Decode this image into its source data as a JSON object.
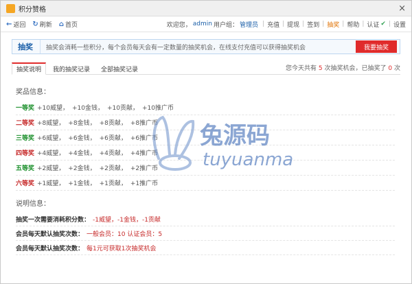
{
  "window": {
    "title": "积分赞格",
    "close": "×"
  },
  "toolbar": {
    "nav": [
      {
        "icon": "back-icon",
        "glyph": "←",
        "label": "返回"
      },
      {
        "icon": "refresh-icon",
        "glyph": "↻",
        "label": "刷新"
      },
      {
        "icon": "home-icon",
        "glyph": "⌂",
        "label": "首页"
      }
    ],
    "greeting": "欢迎您，",
    "user": "admin",
    "group_label": "用户组：",
    "group": "管理员",
    "links": [
      "充值",
      "提现",
      "签到"
    ],
    "lottery": "抽奖",
    "more_links": [
      "帮助",
      "认证"
    ],
    "settings": "设置"
  },
  "banner": {
    "head": "抽奖",
    "desc": "抽奖会消耗一些积分，每个会员每天会有一定数量的抽奖机会，在线支付充值可以获得抽奖机会",
    "button": "我要抽奖"
  },
  "tabs": [
    {
      "label": "抽奖说明",
      "active": true
    },
    {
      "label": "我的抽奖记录",
      "active": false
    },
    {
      "label": "全部抽奖记录",
      "active": false
    }
  ],
  "summary": {
    "prefix": "您今天共有",
    "total": "5",
    "mid": "次抽奖机会，已抽奖了",
    "used": "0",
    "suffix": "次"
  },
  "prizes_title": "奖品信息：",
  "prizes": [
    {
      "level": "一等奖",
      "color": "g",
      "items": [
        "+10威望，",
        "+10金钱，",
        "+10贡献，",
        "+10推广币"
      ]
    },
    {
      "level": "二等奖",
      "color": "r",
      "items": [
        "+8威望，",
        "+8金钱，",
        "+8贡献，",
        "+8推广币"
      ]
    },
    {
      "level": "三等奖",
      "color": "g",
      "items": [
        "+6威望，",
        "+6金钱，",
        "+6贡献，",
        "+6推广币"
      ]
    },
    {
      "level": "四等奖",
      "color": "r",
      "items": [
        "+4威望，",
        "+4金钱，",
        "+4贡献，",
        "+4推广币"
      ]
    },
    {
      "level": "五等奖",
      "color": "g",
      "items": [
        "+2威望，",
        "+2金钱，",
        "+2贡献，",
        "+2推广币"
      ]
    },
    {
      "level": "六等奖",
      "color": "r",
      "items": [
        "+1威望，",
        "+1金钱，",
        "+1贡献，",
        "+1推广币"
      ]
    }
  ],
  "rules_title": "说明信息：",
  "rules": [
    {
      "key": "抽奖一次需要消耗积分数：",
      "value": "-1威望，-1金钱，-1贡献"
    },
    {
      "key": "会员每天默认抽奖次数：",
      "value": "一般会员：10 认证会员：5"
    },
    {
      "key": "会员每天默认抽奖次数：",
      "value": "每1元可获取1次抽奖机会"
    }
  ],
  "watermark": {
    "cn": "兔源码",
    "en": "tuyuanma"
  },
  "colors": {
    "accent": "#e02b2b",
    "link": "#1b5fa8",
    "green": "#1a8f2a"
  }
}
